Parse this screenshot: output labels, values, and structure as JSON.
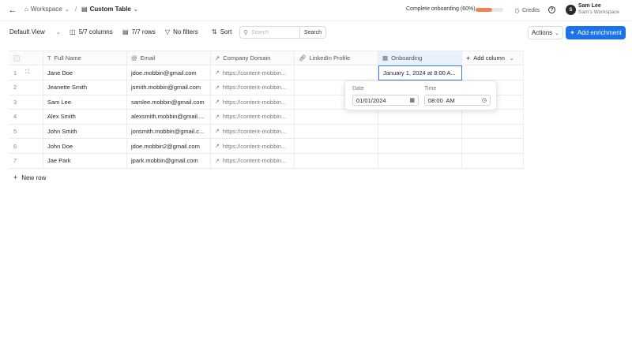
{
  "header": {
    "back_icon": "arrow-left",
    "workspace": "Workspace",
    "table_title": "Custom Table",
    "onboarding_text": "Complete onboarding (60%)",
    "onboarding_progress": 0.6,
    "credits_label": "Credits",
    "avatar_initial": "S",
    "user_name": "Sam Lee",
    "user_workspace": "Sam's Workspace"
  },
  "toolbar": {
    "view_label": "Default View",
    "columns_label": "5/7 columns",
    "rows_label": "7/7 rows",
    "filters_label": "No filters",
    "sort_label": "Sort",
    "search_placeholder": "Search",
    "search_button": "Search",
    "actions_label": "Actions",
    "enrich_label": "Add enrichment",
    "accent_color": "#1a73e8"
  },
  "table": {
    "columns": [
      {
        "label": "Full Name",
        "icon": "text-icon"
      },
      {
        "label": "Email",
        "icon": "at-icon"
      },
      {
        "label": "Company Domain",
        "icon": "external-link-icon"
      },
      {
        "label": "LinkedIn Profile",
        "icon": "link-icon"
      },
      {
        "label": "Onboarding",
        "icon": "calendar-icon"
      }
    ],
    "add_column_label": "Add column",
    "rows": [
      {
        "num": "1",
        "name": "Jane Doe",
        "email": "jdoe.mobbin@gmail.com",
        "domain": "https://content-mobbin...",
        "linkedin": "",
        "onboarding": "January 1, 2024 at 8:00 A..."
      },
      {
        "num": "2",
        "name": "Jeanette Smith",
        "email": "jsmith.mobbin@gmail.com",
        "domain": "https://content-mobbin...",
        "linkedin": "",
        "onboarding": ""
      },
      {
        "num": "3",
        "name": "Sam Lee",
        "email": "samlee.mobbin@gmail.com",
        "domain": "https://content-mobbin...",
        "linkedin": "",
        "onboarding": ""
      },
      {
        "num": "4",
        "name": "Alex Smith",
        "email": "alexsmith.mobbin@gmail....",
        "domain": "https://content-mobbin...",
        "linkedin": "",
        "onboarding": ""
      },
      {
        "num": "5",
        "name": "John Smith",
        "email": "jonsmith.mobbin@gmail.c...",
        "domain": "https://content-mobbin...",
        "linkedin": "",
        "onboarding": ""
      },
      {
        "num": "6",
        "name": "John Doe",
        "email": "jdoe.mobbin2@gmail.com",
        "domain": "https://content-mobbin...",
        "linkedin": "",
        "onboarding": ""
      },
      {
        "num": "7",
        "name": "Jae Park",
        "email": "jpark.mobbin@gmail.com",
        "domain": "https://content-mobbin...",
        "linkedin": "",
        "onboarding": ""
      }
    ],
    "new_row_label": "New row"
  },
  "popover": {
    "date_label": "Date",
    "date_value": "01/01/2024",
    "time_label": "Time",
    "time_value": "08:00  AM"
  }
}
